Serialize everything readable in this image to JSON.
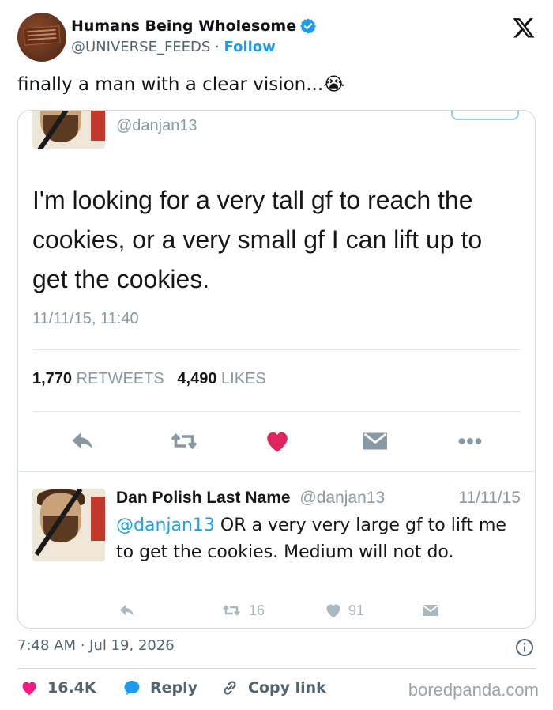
{
  "post": {
    "author_name": "Humans Being Wholesome",
    "author_handle": "@UNIVERSE_FEEDS",
    "separator": "·",
    "follow_label": "Follow",
    "text": "finally a man with a clear vision...",
    "emoji": "😭",
    "timestamp": "7:48 AM · Jul 19, 2026"
  },
  "embedded_tweet": {
    "handle": "@danjan13",
    "text": "I'm looking for a very tall gf to reach the cookies, or a very small gf I can lift up to get the cookies.",
    "date": "11/11/15, 11:40",
    "retweets_count": "1,770",
    "retweets_label": "RETWEETS",
    "likes_count": "4,490",
    "likes_label": "LIKES"
  },
  "reply_tweet": {
    "name": "Dan Polish Last Name",
    "handle": "@danjan13",
    "date": "11/11/15",
    "mention": "@danjan13",
    "text": " OR a very very large gf to lift me to get the cookies. Medium will not do.",
    "retweet_count": "16",
    "like_count": "91"
  },
  "footer": {
    "likes": "16.4K",
    "reply_label": "Reply",
    "copy_label": "Copy link",
    "watermark": "boredpanda.com"
  },
  "colors": {
    "brand_blue": "#1d9bf0",
    "like_red": "#f91880",
    "text_dark": "#0f1419",
    "text_muted": "#536471"
  }
}
